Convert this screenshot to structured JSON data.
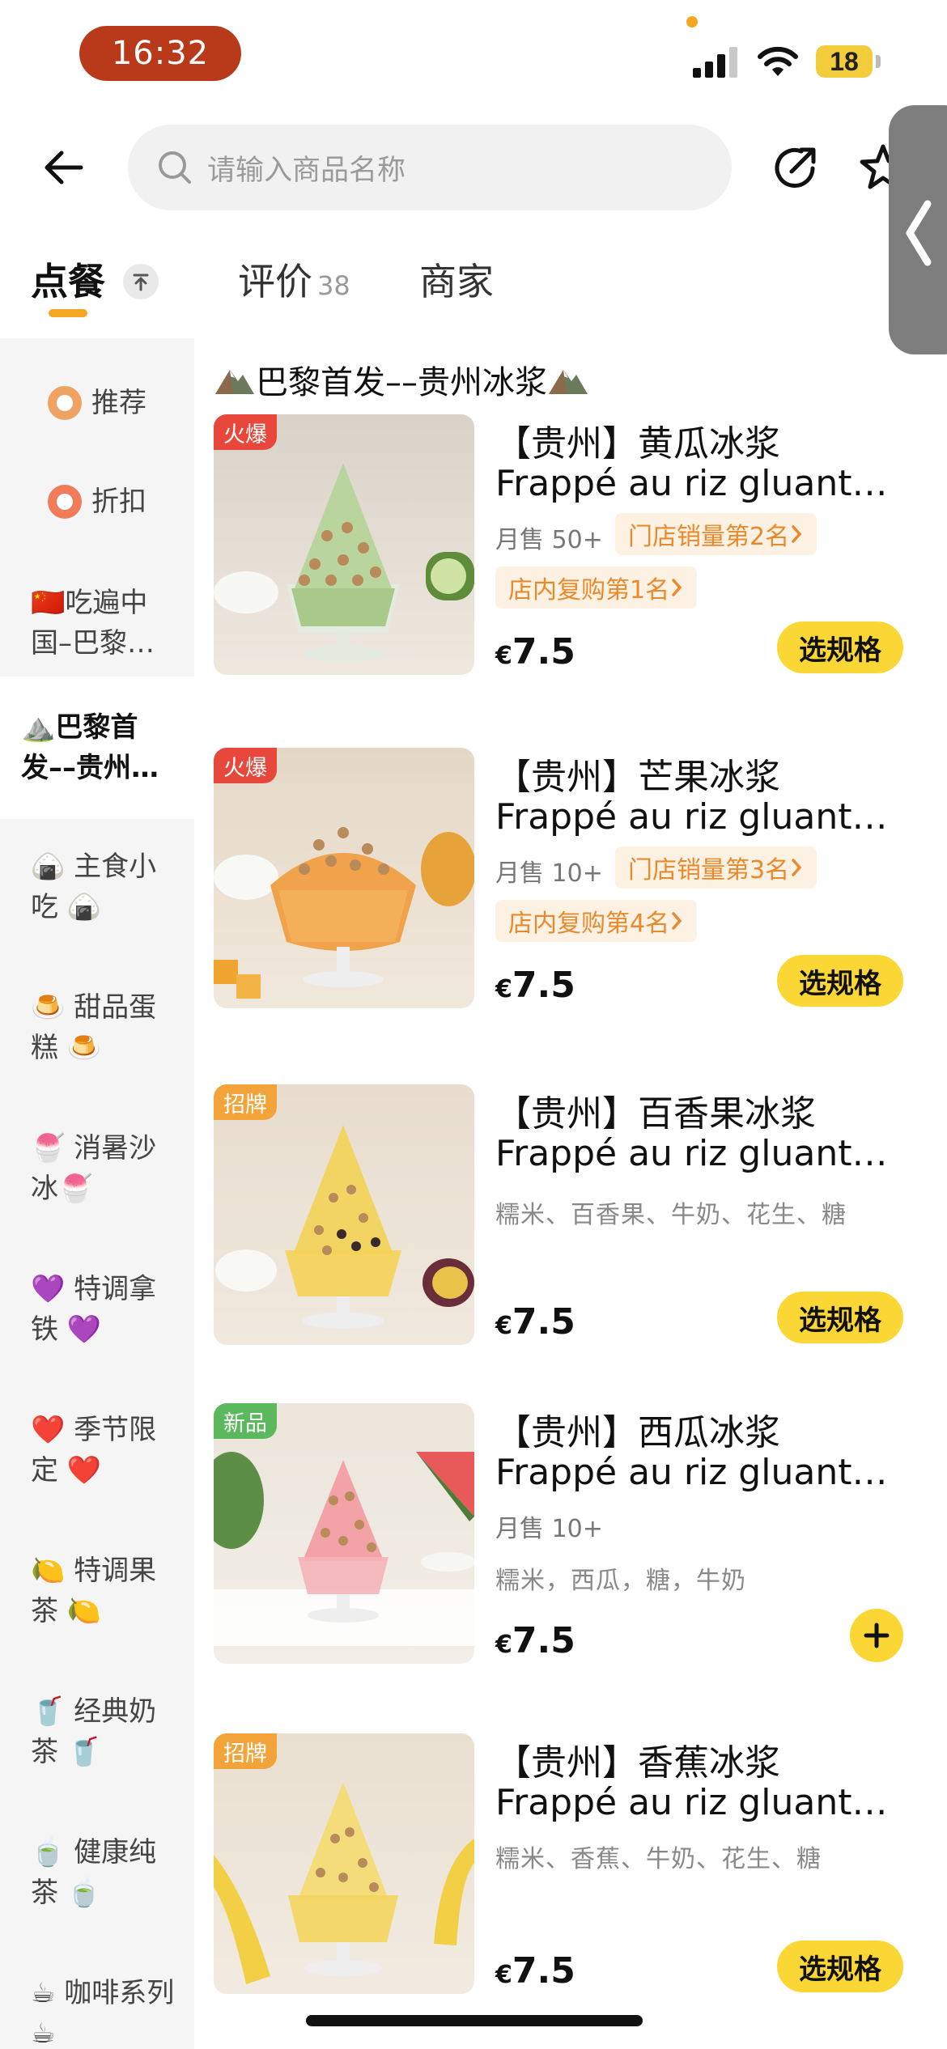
{
  "status_bar": {
    "time": "16:32",
    "battery": "18"
  },
  "header": {
    "search_placeholder": "请输入商品名称"
  },
  "tabs": [
    {
      "label": "点餐"
    },
    {
      "label": "评价",
      "count": "38"
    },
    {
      "label": "商家"
    }
  ],
  "sidebar": {
    "items": [
      {
        "label": "推荐"
      },
      {
        "label": "折扣"
      },
      {
        "label": "🇨🇳吃遍中国–巴黎…"
      },
      {
        "label": "⛰️巴黎首发––贵州…"
      },
      {
        "label": "🍙 主食小吃 🍙"
      },
      {
        "label": "🍮 甜品蛋糕 🍮"
      },
      {
        "label": "🍧 消暑沙冰🍧"
      },
      {
        "label": "💜 特调拿铁 💜"
      },
      {
        "label": "❤️ 季节限定 ❤️"
      },
      {
        "label": "🍋 特调果茶 🍋"
      },
      {
        "label": "🥤 经典奶茶 🥤"
      },
      {
        "label": "🍵 健康纯茶 🍵"
      },
      {
        "label": "☕ 咖啡系列 ☕"
      }
    ]
  },
  "section": {
    "title": "巴黎首发––贵州冰浆"
  },
  "products": [
    {
      "badge": "火爆",
      "badge_color": "#e8473b",
      "name": "【贵州】黄瓜冰浆",
      "subtitle": "Frappé au riz gluant…",
      "sales": "月售 50+",
      "rank1": "门店销量第2名",
      "rank2": "店内复购第1名",
      "currency": "€",
      "price": "7.5",
      "action": "选规格"
    },
    {
      "badge": "火爆",
      "badge_color": "#e8473b",
      "name": "【贵州】芒果冰浆",
      "subtitle": "Frappé au riz gluant…",
      "sales": "月售 10+",
      "rank1": "门店销量第3名",
      "rank2": "店内复购第4名",
      "currency": "€",
      "price": "7.5",
      "action": "选规格"
    },
    {
      "badge": "招牌",
      "badge_color": "#f2a43a",
      "name": "【贵州】百香果冰浆",
      "subtitle": "Frappé au riz gluant…",
      "desc": "糯米、百香果、牛奶、花生、糖",
      "currency": "€",
      "price": "7.5",
      "action": "选规格"
    },
    {
      "badge": "新品",
      "badge_color": "#5cb85c",
      "name": "【贵州】西瓜冰浆",
      "subtitle": "Frappé au riz gluant…",
      "sales": "月售 10+",
      "desc": "糯米，西瓜，糖，牛奶",
      "currency": "€",
      "price": "7.5"
    },
    {
      "badge": "招牌",
      "badge_color": "#f2a43a",
      "name": "【贵州】香蕉冰浆",
      "subtitle": "Frappé au riz gluant…",
      "desc": "糯米、香蕉、牛奶、花生、糖",
      "currency": "€",
      "price": "7.5",
      "action": "选规格"
    }
  ]
}
